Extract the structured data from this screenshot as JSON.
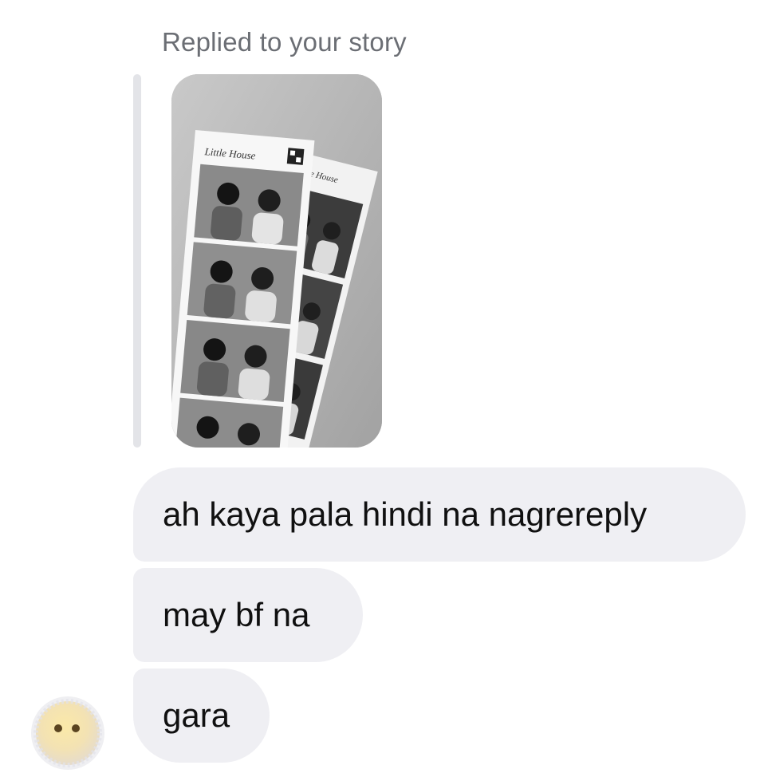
{
  "story_reply": {
    "context_label": "Replied to your story",
    "preview": {
      "description_icon": "photo-strip-image",
      "strip_header": "Little House"
    }
  },
  "messages": [
    {
      "text": "ah kaya pala hindi na nagrereply"
    },
    {
      "text": "may bf na"
    },
    {
      "text": "gara"
    }
  ],
  "sender": {
    "avatar_icon": "blurred-face-emoji-avatar"
  },
  "colors": {
    "bubble_background": "#efeff3",
    "bubble_text": "#101010",
    "context_text": "#6b6e74",
    "quote_bar": "#e3e4e8"
  }
}
